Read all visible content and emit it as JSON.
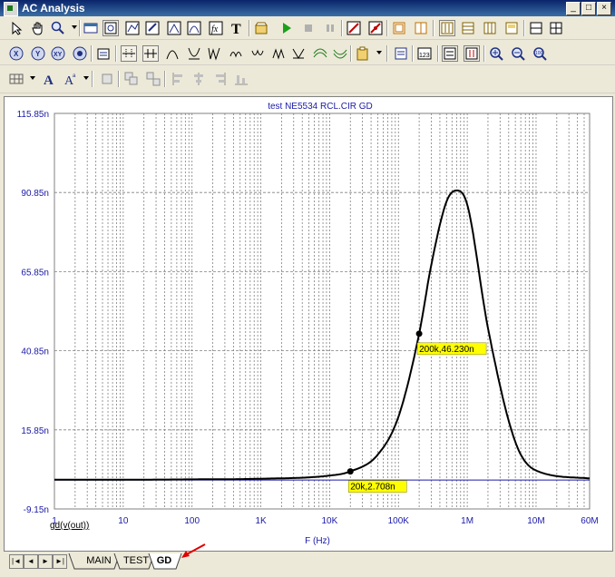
{
  "window": {
    "title": "AC Analysis",
    "buttons": [
      "_",
      "□",
      "×"
    ]
  },
  "toolbars": {
    "row1": [
      "select-tool",
      "pan-tool",
      "zoom-tool",
      "dropdown",
      "open-plot",
      "scale-plot",
      "text-tool",
      "formula-tool",
      "label-tool",
      "run",
      "stop",
      "pause",
      "cursor-a",
      "cursor-b",
      "layout-1",
      "layout-2",
      "layout-3",
      "layout-4",
      "layout-5",
      "layout-6",
      "layout-7"
    ],
    "row2": [
      "zoom-x",
      "zoom-y",
      "zoom-fit",
      "properties",
      "peak",
      "valley",
      "high",
      "low",
      "inflection",
      "global-high",
      "global-low",
      "top",
      "bottom",
      "next-data",
      "prev-data",
      "grid",
      "data-table",
      "cursor-mode",
      "zoom-in",
      "zoom-out",
      "zoom-100"
    ],
    "row3": [
      "grid-toggle",
      "text-A",
      "font-A",
      "align-left",
      "align-center",
      "align-right",
      "align-bottom"
    ]
  },
  "plot": {
    "title": "test NE5534 RCL.CIR GD",
    "xlabel": "F (Hz)",
    "ylabel_trace": "gd(v(out))",
    "y_ticks": [
      "115.85n",
      "90.85n",
      "65.85n",
      "40.85n",
      "15.85n",
      "-9.15n"
    ],
    "x_ticks": [
      "1",
      "10",
      "100",
      "1K",
      "10K",
      "100K",
      "1M",
      "10M",
      "60M"
    ],
    "annotations": [
      "200k,46.230n",
      "20k,2.708n"
    ],
    "colors": {
      "trace": "#000000",
      "axis_text": "#1a1aa8",
      "grid": "#808080",
      "label_bg": "#ffff00",
      "baseline": "#1a1aa8"
    }
  },
  "chart_data": {
    "type": "line",
    "title": "test NE5534 RCL.CIR GD",
    "xlabel": "F (Hz)",
    "ylabel": "gd(v(out))",
    "x_scale": "log",
    "xlim": [
      1,
      60000000
    ],
    "ylim": [
      -9.15e-09,
      1.1585e-07
    ],
    "series": [
      {
        "name": "gd(v(out))",
        "x": [
          1,
          10,
          100,
          1000,
          10000,
          20000,
          50000,
          100000,
          200000,
          300000,
          500000,
          700000,
          1000000,
          2000000,
          5000000,
          10000000,
          60000000
        ],
        "y": [
          1e-10,
          1e-10,
          2e-10,
          4e-10,
          1.4e-09,
          2.708e-09,
          8e-09,
          2e-08,
          4.623e-08,
          6.8e-08,
          8.8e-08,
          9.15e-08,
          8.7e-08,
          4.8e-08,
          1.2e-08,
          3e-09,
          5e-10
        ]
      }
    ],
    "points": [
      {
        "x": 200000,
        "y": 4.623e-08,
        "label": "200k,46.230n"
      },
      {
        "x": 20000,
        "y": 2.708e-09,
        "label": "20k,2.708n"
      }
    ],
    "grid": true
  },
  "tabs": {
    "nav": [
      "|◄",
      "◄",
      "►",
      "►|"
    ],
    "items": [
      "MAIN",
      "TEST",
      "GD"
    ],
    "active": "GD"
  }
}
